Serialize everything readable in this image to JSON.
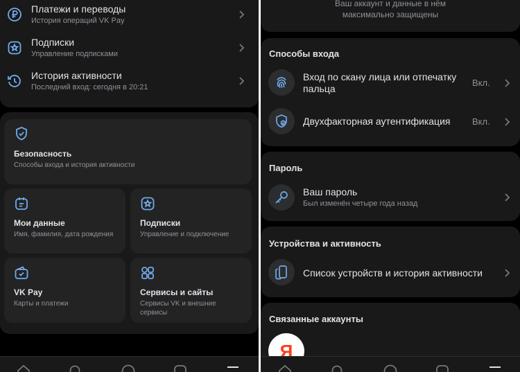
{
  "colors": {
    "background": "#000000",
    "card": "#19191a",
    "tile": "#232324",
    "accent": "#71aaeb",
    "text": "#e1e3e6",
    "muted": "#8e9399",
    "yandex": "#fc3f1d"
  },
  "left": {
    "menu": [
      {
        "title": "Платежи и переводы",
        "subtitle": "История операций VK Pay",
        "icon": "ruble-icon"
      },
      {
        "title": "Подписки",
        "subtitle": "Управление подписками",
        "icon": "star-icon"
      },
      {
        "title": "История активности",
        "subtitle": "Последний вход: сегодня в 20:21",
        "icon": "history-icon"
      }
    ],
    "tiles": {
      "security": {
        "title": "Безопасность",
        "subtitle": "Способы входа и история активности",
        "icon": "shield-icon"
      },
      "mydata": {
        "title": "Мои данные",
        "subtitle": "Имя, фамилия, дата рождения",
        "icon": "id-card-icon"
      },
      "subscriptions": {
        "title": "Подписки",
        "subtitle": "Управление и подключение",
        "icon": "star-icon"
      },
      "vkpay": {
        "title": "VK Pay",
        "subtitle": "Карты и платежи",
        "icon": "wallet-icon"
      },
      "services": {
        "title": "Сервисы и сайты",
        "subtitle_line1": "Сервисы VK и внешние",
        "subtitle_line2": "сервисы",
        "icon": "apps-icon"
      }
    }
  },
  "right": {
    "top_text_line1": "Ваш аккаунт и данные в нём",
    "top_text_line2": "максимально защищены",
    "login": {
      "heading": "Способы входа",
      "items": [
        {
          "title_line1": "Вход по скану лица или отпечатку",
          "title_line2": "пальца",
          "status": "Вкл.",
          "icon": "fingerprint-icon"
        },
        {
          "title": "Двухфакторная аутентификация",
          "status": "Вкл.",
          "icon": "shield-check-icon"
        }
      ]
    },
    "password": {
      "heading": "Пароль",
      "title": "Ваш пароль",
      "subtitle": "Был изменён четыре года назад",
      "icon": "key-icon"
    },
    "devices": {
      "heading": "Устройства и активность",
      "title": "Список устройств и история активности",
      "icon": "devices-icon"
    },
    "linked": {
      "heading": "Связанные аккаунты",
      "yandex_letter": "Я"
    }
  }
}
